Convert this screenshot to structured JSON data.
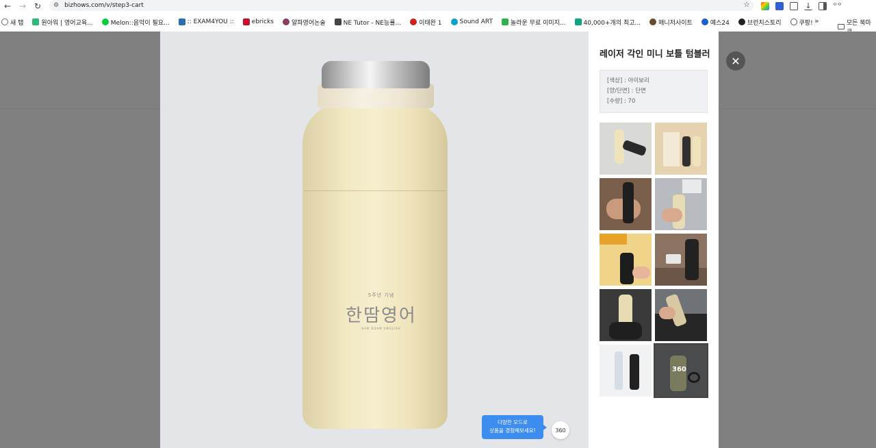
{
  "browser": {
    "url": "bizhows.com/v/step3-cart",
    "bookmarks": [
      {
        "label": "새 탭",
        "color": "#666666"
      },
      {
        "label": "원아워 | 영어교육...",
        "color": "#2fb87a"
      },
      {
        "label": "Melon::음악이 필요...",
        "color": "#00cd3c"
      },
      {
        "label": ":: EXAM4YOU ::",
        "color": "#2a6fb0"
      },
      {
        "label": "ebricks",
        "color": "#c8102e"
      },
      {
        "label": "알파영어논술",
        "color": "#8b3a62"
      },
      {
        "label": "NE Tutor - NE능률...",
        "color": "#444444"
      },
      {
        "label": "이태완 1",
        "color": "#d0201a"
      },
      {
        "label": "Sound ART",
        "color": "#0aa0c8"
      },
      {
        "label": "놀라운 무료 이미지...",
        "color": "#2db34a"
      },
      {
        "label": "40,000+개의 최고...",
        "color": "#10a37f"
      },
      {
        "label": "매니저사이트",
        "color": "#6b4a2b"
      },
      {
        "label": "예스24",
        "color": "#1a5fd0"
      },
      {
        "label": "브런치스토리",
        "color": "#222222"
      },
      {
        "label": "쿠팡!",
        "color": "#555555"
      }
    ],
    "more": "»",
    "folder_label": "모든 북마크"
  },
  "product": {
    "title": "레이저 각인 미니 보틀 텀블러",
    "options": [
      "[색상] : 아이보리",
      "[양/단면] : 단면",
      "[수량] : 70"
    ],
    "engraving": {
      "subtitle": "5주년 기념",
      "main": "한땀영어",
      "caption": "HAN DDAM ENGLISH"
    }
  },
  "thumbnails": [
    {
      "name": "ivory-and-black-bottles",
      "bg": "#d9d9d6"
    },
    {
      "name": "boxes-packaging",
      "bg": "#e6d2ae"
    },
    {
      "name": "hand-holding-black-bottle",
      "bg": "#8a6a55"
    },
    {
      "name": "hand-holding-ivory-bottle",
      "bg": "#b8bcc0"
    },
    {
      "name": "pouring-juice",
      "bg": "#e4b84a"
    },
    {
      "name": "black-bottle-on-table",
      "bg": "#8c7260"
    },
    {
      "name": "bottle-in-car-holder",
      "bg": "#3a3a3a"
    },
    {
      "name": "bottle-in-bag",
      "bg": "#6f7378"
    },
    {
      "name": "size-comparison",
      "bg": "#f1f2f4"
    },
    {
      "name": "view-360",
      "bg": "#4a4b4d"
    }
  ],
  "badge_360": "360",
  "tooltip": {
    "line1": "다양한 모드로",
    "line2": "상품을 경험해보세요!"
  },
  "btn_360_label": "360"
}
